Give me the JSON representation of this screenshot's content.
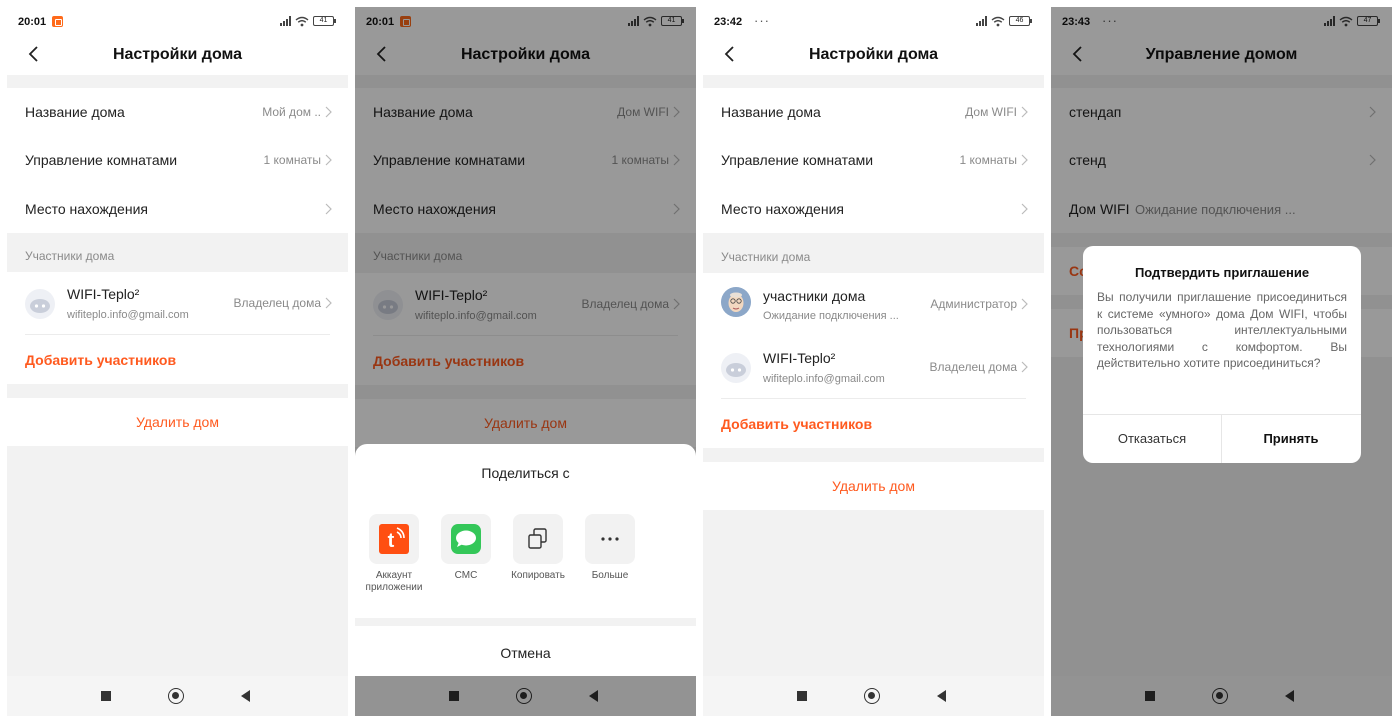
{
  "colors": {
    "accent": "#ff5a1f",
    "tuya_brand": "#ff4f12",
    "sms_green": "#34c759"
  },
  "screen1": {
    "status": {
      "time": "20:01",
      "battery": "41"
    },
    "title": "Настройки дома",
    "rows": [
      {
        "label": "Название дома",
        "value": "Мой дом .."
      },
      {
        "label": "Управление комнатами",
        "value": "1 комнаты"
      },
      {
        "label": "Место нахождения",
        "value": ""
      }
    ],
    "members_section": "Участники дома",
    "members": [
      {
        "name": "WIFI-Teplo²",
        "sub": "wifiteplo.info@gmail.com",
        "role": "Владелец дома"
      }
    ],
    "add_members": "Добавить участников",
    "delete_home": "Удалить дом"
  },
  "screen2": {
    "status": {
      "time": "20:01",
      "battery": "41"
    },
    "title": "Настройки дома",
    "rows": [
      {
        "label": "Название дома",
        "value": "Дом WIFI"
      },
      {
        "label": "Управление комнатами",
        "value": "1 комнаты"
      },
      {
        "label": "Место нахождения",
        "value": ""
      }
    ],
    "members_section": "Участники дома",
    "members": [
      {
        "name": "WIFI-Teplo²",
        "sub": "wifiteplo.info@gmail.com",
        "role": "Владелец дома"
      }
    ],
    "add_members": "Добавить участников",
    "delete_home": "Удалить дом",
    "share": {
      "title": "Поделиться с",
      "options": [
        {
          "label": "Аккаунт приложении",
          "icon": "tuya-app-icon"
        },
        {
          "label": "СМС",
          "icon": "sms-icon"
        },
        {
          "label": "Копировать",
          "icon": "copy-icon"
        },
        {
          "label": "Больше",
          "icon": "more-icon"
        }
      ],
      "cancel": "Отмена"
    }
  },
  "screen3": {
    "status": {
      "time": "23:42",
      "battery": "46"
    },
    "title": "Настройки дома",
    "rows": [
      {
        "label": "Название дома",
        "value": "Дом WIFI"
      },
      {
        "label": "Управление комнатами",
        "value": "1 комнаты"
      },
      {
        "label": "Место нахождения",
        "value": ""
      }
    ],
    "members_section": "Участники дома",
    "members": [
      {
        "name": "участники дома",
        "sub": "Ожидание подключения ...",
        "role": "Администратор"
      },
      {
        "name": "WIFI-Teplo²",
        "sub": "wifiteplo.info@gmail.com",
        "role": "Владелец дома"
      }
    ],
    "add_members": "Добавить участников",
    "delete_home": "Удалить дом"
  },
  "screen4": {
    "status": {
      "time": "23:43",
      "battery": "47"
    },
    "title": "Управление домом",
    "homes": [
      {
        "name": "стендап",
        "status": ""
      },
      {
        "name": "стенд",
        "status": ""
      },
      {
        "name": "Дом WIFI",
        "status": "Ожидание подключения ..."
      }
    ],
    "hidden_1": "Со",
    "hidden_2": "Пр",
    "dialog": {
      "title": "Подтвердить приглашение",
      "body": "Вы получили приглашение присоединиться к системе «умного» дома Дом WIFI, чтобы пользоваться интеллектуальными технологиями с комфортом. Вы действительно хотите присоединиться?",
      "decline": "Отказаться",
      "accept": "Принять"
    }
  }
}
